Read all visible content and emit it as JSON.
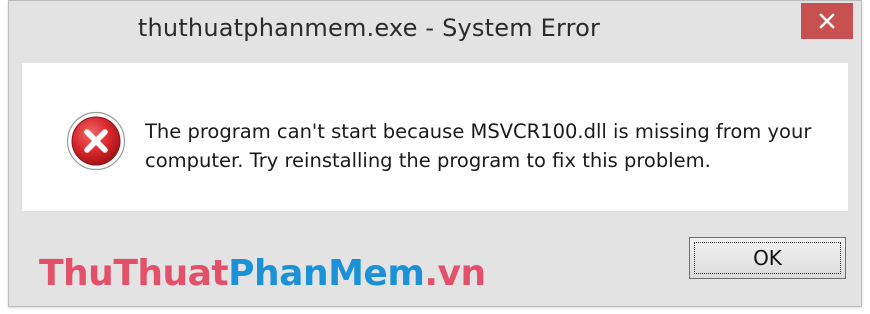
{
  "dialog": {
    "title": "thuthuatphanmem.exe - System Error",
    "close_icon": "close-icon",
    "error_icon": "error-icon",
    "message_line1": "The program can't start because MSVCR100.dll is missing from your",
    "message_line2": "computer. Try reinstalling the program to fix this problem.",
    "ok_label": "OK"
  },
  "watermark": {
    "part1": "ThuThuat",
    "part2": "PhanMem",
    "part3": ".vn"
  },
  "colors": {
    "close_button": "#c75050",
    "watermark_pink": "#e3506a",
    "watermark_blue": "#1b92d8",
    "error_red": "#d9262b"
  }
}
